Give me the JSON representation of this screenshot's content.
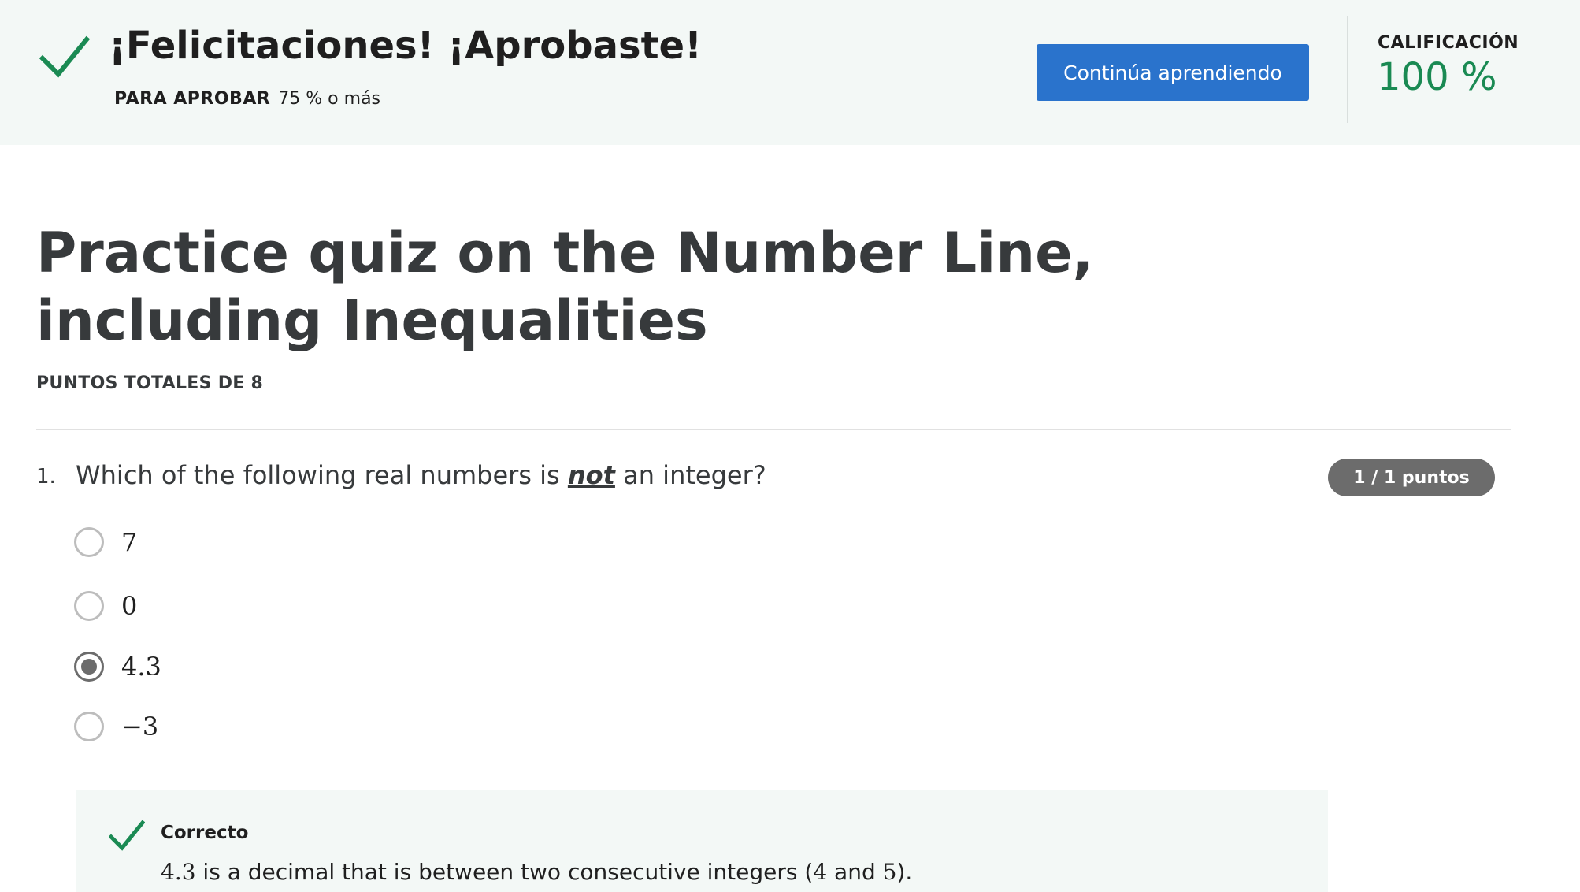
{
  "banner": {
    "title": "¡Felicitaciones! ¡Aprobaste!",
    "pass_label": "PARA APROBAR",
    "pass_value": "75 % o más",
    "continue_label": "Continúa aprendiendo",
    "grade_label": "CALIFICACIÓN",
    "grade_value": "100 %"
  },
  "quiz": {
    "title": "Practice quiz on the Number Line, including Inequalities",
    "total_points": "PUNTOS TOTALES DE 8"
  },
  "question": {
    "number": "1.",
    "text_before": "Which of the following real numbers is ",
    "text_emphasis": "not",
    "text_after": " an integer?",
    "points_badge": "1 / 1 puntos",
    "options": [
      {
        "label": "7",
        "selected": false
      },
      {
        "label": "0",
        "selected": false
      },
      {
        "label": "4.3",
        "selected": true
      },
      {
        "label": "−3",
        "selected": false
      }
    ]
  },
  "feedback": {
    "status": "Correcto",
    "value_a": "4.3",
    "text_1": " is a decimal that is between two consecutive integers (",
    "value_b": "4",
    "text_2": " and ",
    "value_c": "5",
    "text_3": ")."
  },
  "colors": {
    "success": "#1a8a53",
    "primary": "#2a73cc",
    "banner_bg": "#f3f8f6",
    "badge_bg": "#6c6c6c"
  }
}
